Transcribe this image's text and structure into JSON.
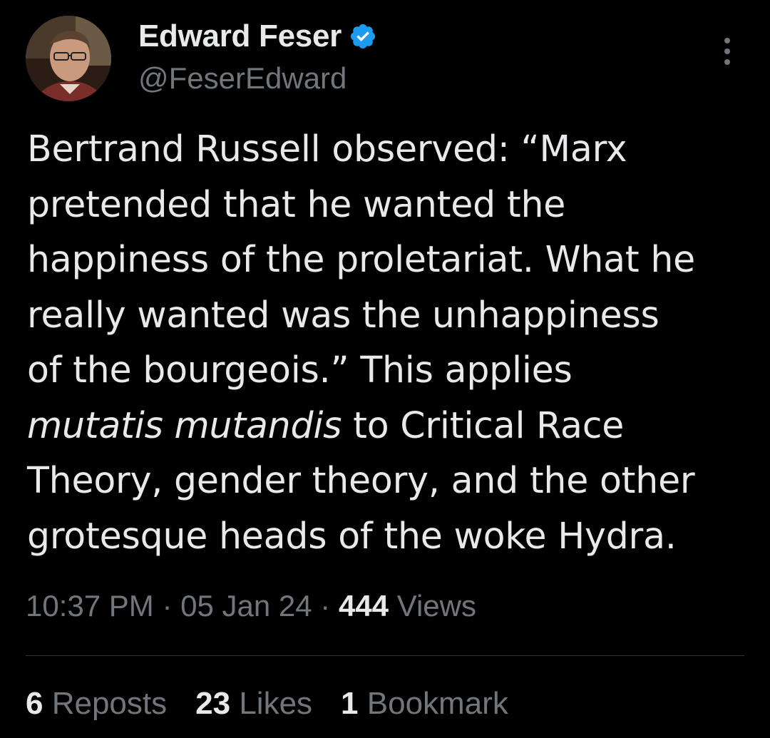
{
  "author": {
    "display_name": "Edward Feser",
    "handle": "@FeserEdward",
    "verified": true,
    "verified_color": "#1d9bf0"
  },
  "tweet": {
    "lines": [
      "Bertrand Russell observed: “Marx",
      "pretended that he wanted the",
      "happiness of the proletariat. What he",
      "really wanted was the unhappiness",
      "of the bourgeois.” This applies"
    ],
    "italic_phrase": "mutatis mutandis",
    "line6_rest": " to Critical Race",
    "lines_after": [
      "Theory, gender theory, and the other",
      "grotesque heads of the woke Hydra."
    ]
  },
  "meta": {
    "time": "10:37 PM",
    "separator": "·",
    "date": "05 Jan 24",
    "views_count": "444",
    "views_label": "Views"
  },
  "stats": {
    "reposts_count": "6",
    "reposts_label": "Reposts",
    "likes_count": "23",
    "likes_label": "Likes",
    "bookmarks_count": "1",
    "bookmarks_label": "Bookmark"
  },
  "colors": {
    "background": "#000000",
    "text_primary": "#e7e9ea",
    "text_secondary": "#71767b",
    "divider": "#2f3336"
  },
  "icons": {
    "avatar": "profile-photo",
    "verified": "verified-badge-icon",
    "more": "more-options-icon"
  }
}
